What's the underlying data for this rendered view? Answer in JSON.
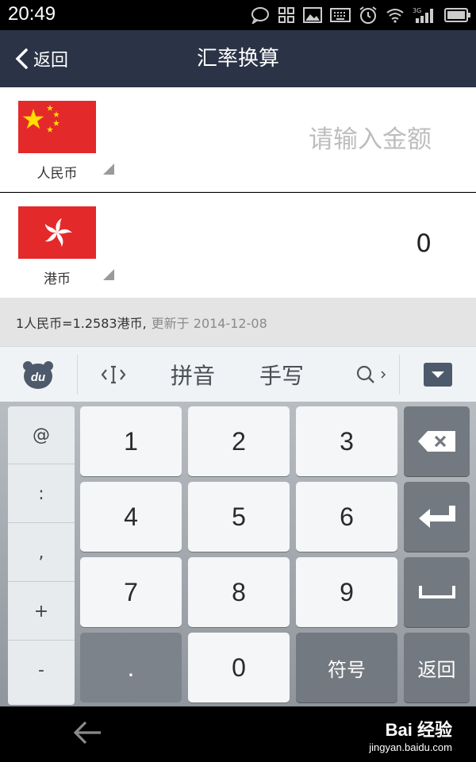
{
  "status_bar": {
    "time": "20:49",
    "network": "3G"
  },
  "header": {
    "back_label": "返回",
    "title": "汇率换算"
  },
  "from_currency": {
    "name": "人民币",
    "placeholder": "请输入金额",
    "flag": "china-flag"
  },
  "to_currency": {
    "name": "港币",
    "result": "0",
    "flag": "hong-kong-flag"
  },
  "rate_info": {
    "rate_text": "1人民币=1.2583港币,",
    "updated_text": "更新于 2014-12-08"
  },
  "keyboard_toolbar": {
    "pinyin_label": "拼音",
    "handwriting_label": "手写",
    "du_logo": "du"
  },
  "keyboard": {
    "symbols": [
      "@",
      ":",
      ",",
      "+",
      "-"
    ],
    "digits": [
      "1",
      "2",
      "3",
      "4",
      "5",
      "6",
      "7",
      "8",
      "9",
      "0"
    ],
    "dot": ".",
    "symbol_key": "符号",
    "return_key": "返回"
  },
  "watermark": {
    "logo_text": "Bai 经验",
    "url": "jingyan.baidu.com"
  },
  "colors": {
    "header_bg": "#2b3446",
    "flag_red": "#e4292a",
    "star_yellow": "#ffde00"
  }
}
